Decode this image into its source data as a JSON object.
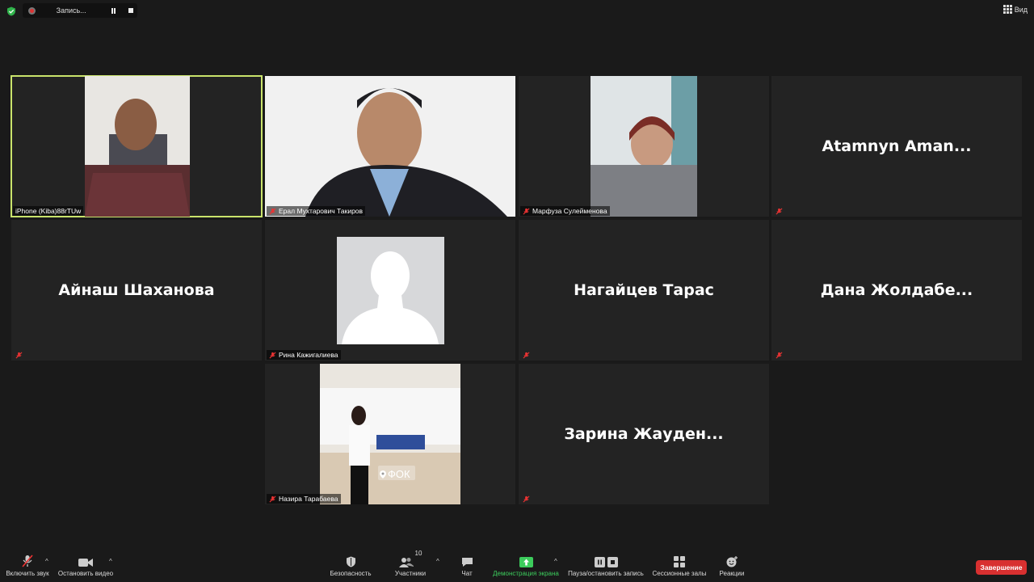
{
  "topbar": {
    "recording_label": "Запись...",
    "view_label": "Вид"
  },
  "tiles": [
    {
      "label": "iPhone (Kiba)88rTUw"
    },
    {
      "label": "Ерал Мухтарович Такиров"
    },
    {
      "label": "Марфуза Сулейменова"
    },
    {
      "name": "Atamnyn  Aman..."
    },
    {
      "name": "Айнаш Шаханова"
    },
    {
      "label": "Рина Кажигалиева"
    },
    {
      "name": "Нагайцев Тарас"
    },
    {
      "name": "Дана  Жолдабе..."
    },
    {
      "label": "Назира Тарабаева",
      "overlay": "ФОК"
    },
    {
      "name": "Зарина  Жауден..."
    }
  ],
  "toolbar": {
    "unmute_label": "Включить звук",
    "video_label": "Остановить видео",
    "security_label": "Безопасность",
    "participants_label": "Участники",
    "participants_count": "10",
    "chat_label": "Чат",
    "share_label": "Демонстрация экрана",
    "record_label": "Пауза/остановить запись",
    "breakout_label": "Сессионные залы",
    "reactions_label": "Реакции",
    "end_label": "Завершение"
  },
  "colors": {
    "active_speaker": "#c9e36b",
    "share_green": "#3ccc5c",
    "end_red": "#d83030",
    "background": "#1a1a1a",
    "tile": "#232323"
  }
}
